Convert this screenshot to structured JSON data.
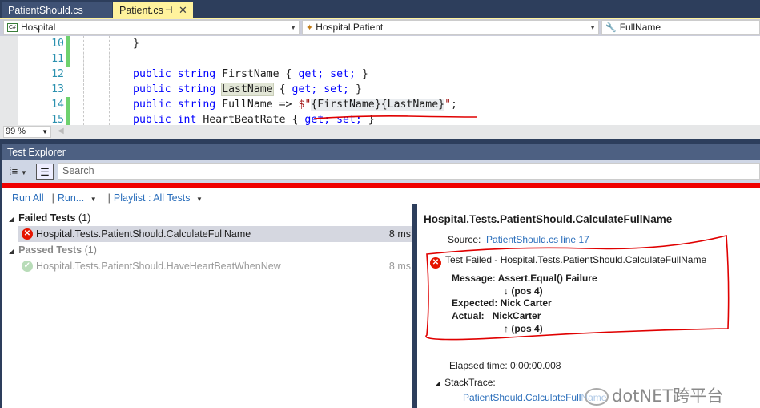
{
  "tabs": [
    {
      "label": "PatientShould.cs",
      "active": false
    },
    {
      "label": "Patient.cs",
      "active": true,
      "pin_icon": "pin-icon",
      "close_icon": "close-icon"
    }
  ],
  "navbar": {
    "project": "Hospital",
    "type": "Hospital.Patient",
    "member": "FullName"
  },
  "editor": {
    "lines": [
      {
        "num": "10",
        "changed": true
      },
      {
        "num": "11",
        "changed": true
      },
      {
        "num": "12",
        "changed": false
      },
      {
        "num": "13",
        "changed": false
      },
      {
        "num": "14",
        "changed": true
      },
      {
        "num": "15",
        "changed": true
      }
    ],
    "code": {
      "l10": "}",
      "l12_kw": "public string",
      "l12_rest": " FirstName { ",
      "l12_get": "get; set;",
      "l12_end": " }",
      "l13_kw": "public string",
      "l13_name": "LastName",
      "l13_rest": " { ",
      "l13_get": "get; set;",
      "l13_end": " }",
      "l14_kw": "public string",
      "l14_rest": " FullName => ",
      "l14_str_open": "$\"",
      "l14_first": "{FirstName}",
      "l14_last": "{LastName}",
      "l14_str_close": "\"",
      "l14_end": ";",
      "l15_kw": "public int",
      "l15_rest": " HeartBeatRate { ",
      "l15_get": "get; set;",
      "l15_end": " }"
    },
    "zoom": "99 %"
  },
  "test_explorer": {
    "title": "Test Explorer",
    "search_placeholder": "Search",
    "status_color": "#f00000",
    "actions": {
      "run_all": "Run All",
      "run": "Run...",
      "playlist": "Playlist : All Tests"
    },
    "groups": [
      {
        "name": "Failed Tests",
        "count": "(1)",
        "tests": [
          {
            "name": "Hospital.Tests.PatientShould.CalculateFullName",
            "duration": "8 ms",
            "status": "failed"
          }
        ]
      },
      {
        "name": "Passed Tests",
        "count": "(1)",
        "tests": [
          {
            "name": "Hospital.Tests.PatientShould.HaveHeartBeatWhenNew",
            "duration": "8 ms",
            "status": "passed"
          }
        ]
      }
    ],
    "detail": {
      "title": "Hospital.Tests.PatientShould.CalculateFullName",
      "source_label": "Source:",
      "source_link": "PatientShould.cs line 17",
      "failed_line": "Test Failed - Hospital.Tests.PatientShould.CalculateFullName",
      "message_label": "Message: Assert.Equal() Failure",
      "pos_down": "↓ (pos 4)",
      "expected": "Expected: Nick Carter",
      "actual_label": "Actual:",
      "actual_value": "NickCarter",
      "pos_up": "↑ (pos 4)",
      "elapsed": "Elapsed time: 0:00:00.008",
      "stacktrace_label": "StackTrace:",
      "stacktrace_link": "PatientShould.CalculateFullName"
    }
  },
  "watermark": "dotNET跨平台"
}
